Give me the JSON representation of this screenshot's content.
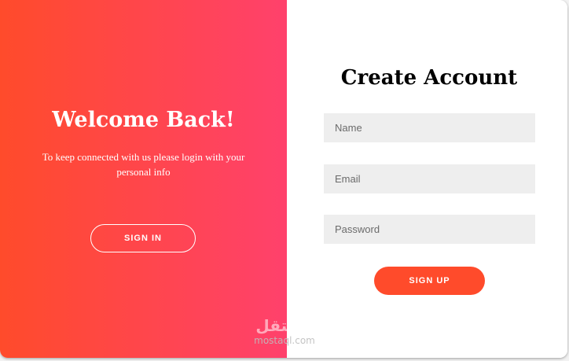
{
  "overlay": {
    "title": "Welcome Back!",
    "message": "To keep connected with us please login with your personal info",
    "signin_label": "SIGN IN",
    "gradient_from": "#ff4b2b",
    "gradient_to": "#ff416c"
  },
  "signup_form": {
    "title": "Create Account",
    "name": {
      "value": "",
      "placeholder": "Name"
    },
    "email": {
      "value": "",
      "placeholder": "Email"
    },
    "password": {
      "value": "",
      "placeholder": "Password"
    },
    "submit_label": "SIGN UP",
    "accent": "#ff4b2b",
    "field_background": "#eeeeee"
  },
  "watermark": {
    "logo": "مستقل",
    "url": "mostaql.com"
  }
}
